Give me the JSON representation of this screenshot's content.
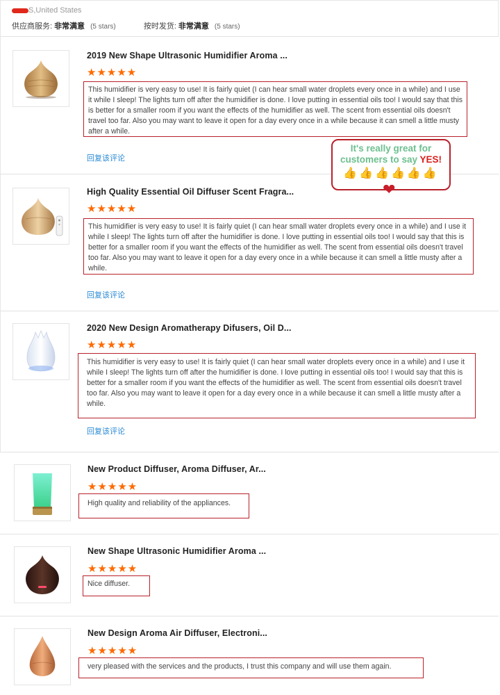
{
  "header": {
    "location": "S,United States",
    "ratings": [
      {
        "label": "供应商服务:",
        "value": "非常满意",
        "stars": "(5 stars)"
      },
      {
        "label": "按时发货:",
        "value": "非常满意",
        "stars": "(5 stars)"
      }
    ]
  },
  "promo": {
    "line1": "It's really great for",
    "line2": "customers to say",
    "yes": "YES!",
    "thumbs": "👍👍👍👍👍👍",
    "heart": "❤"
  },
  "reviews": [
    {
      "title": "2019 New Shape Ultrasonic Humidifier Aroma ...",
      "stars": "★★★★★",
      "text": "This humidifier is very easy to use! It is fairly quiet (I can hear small water droplets every once in a while) and I use it while I sleep! The lights turn off after the humidifier is done. I love putting in essential oils too! I would say that this is better for a smaller room if you want the effects of the humidifier as well. The scent from essential oils doesn't travel too far. Also you may want to leave it open for a day every once in a while because it can smell a little musty after a while.",
      "reply": "回复该评论"
    },
    {
      "title": "High Quality Essential Oil Diffuser Scent Fragra...",
      "stars": "★★★★★",
      "text": "This humidifier is very easy to use! It is fairly quiet (I can hear small water droplets every once in a while) and I use it while I sleep! The lights turn off after the humidifier is done. I love putting in essential oils too! I would say that this is better for a smaller room if you want the effects of the humidifier as well. The scent from essential oils doesn't travel too far. Also you may want to leave it open for a day every once in a while because it can smell a little musty after a while.",
      "reply": "回复该评论"
    },
    {
      "title": "2020 New Design Aromatherapy Difusers, Oil D...",
      "stars": "★★★★★",
      "text": "This humidifier is very easy to use! It is fairly quiet (I can hear small water droplets every once in a while) and I use it while I sleep! The lights turn off after the humidifier is done. I love putting in essential oils too! I would say that this is better for a smaller room if you want the effects of the humidifier as well. The scent from essential oils doesn't travel too far. Also you may want to leave it open for a day every once in a while because it can smell a little musty after a while.",
      "reply": "回复该评论"
    },
    {
      "title": "New Product Diffuser, Aroma Diffuser, Ar...",
      "stars": "★★★★★",
      "text": "High quality and reliability of the appliances."
    },
    {
      "title": "New Shape Ultrasonic Humidifier Aroma ...",
      "stars": "★★★★★",
      "text": "Nice diffuser."
    },
    {
      "title": "New Design Aroma Air Diffuser, Electroni...",
      "stars": "★★★★★",
      "text": "very pleased with the services and the products, I trust this company and will use them again."
    }
  ]
}
